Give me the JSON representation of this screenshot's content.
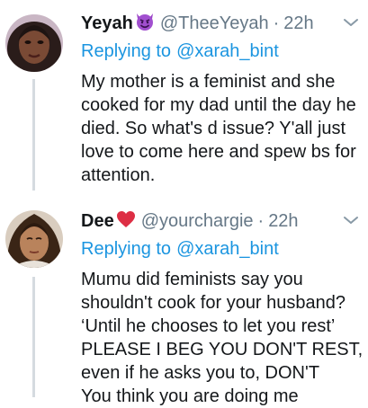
{
  "tweets": [
    {
      "display_name": "Yeyah",
      "name_emoji": "smiling-devil-emoji",
      "handle": "@TheeYeyah",
      "separator": "·",
      "time": "22h",
      "replying_prefix": "Replying to",
      "replying_to": "@xarah_bint",
      "lines": [
        "My mother is a feminist and she",
        "cooked for my dad until the day he",
        "died. So what's d issue? Y'all just",
        "love to come here and spew bs for",
        "attention."
      ]
    },
    {
      "display_name": "Dee",
      "name_emoji": "red-heart-emoji",
      "handle": "@yourchargie",
      "separator": "·",
      "time": "22h",
      "replying_prefix": "Replying to",
      "replying_to": "@xarah_bint",
      "lines": [
        "Mumu did feminists say you",
        "shouldn't cook for your husband?",
        "‘Until he chooses to let you rest’",
        "PLEASE I BEG YOU DON'T REST,",
        "even if he asks you to, DON'T",
        "You think you are doing me"
      ]
    }
  ],
  "colors": {
    "text": "#14171a",
    "secondary": "#657786",
    "link": "#1b95e0",
    "thread_line": "#d5dbe0"
  }
}
